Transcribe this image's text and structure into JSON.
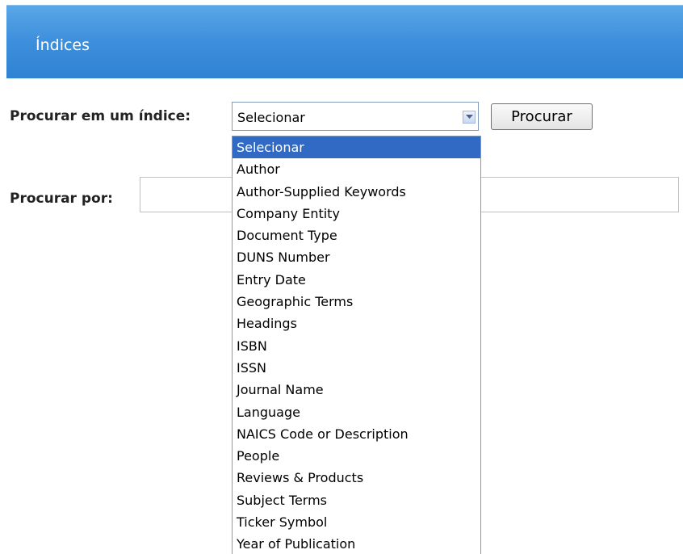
{
  "header": {
    "title": "Índices"
  },
  "index_search": {
    "label": "Procurar em um índice:",
    "selected": "Selecionar",
    "button_label": "Procurar"
  },
  "search_for": {
    "label": "Procurar por:",
    "value": ""
  },
  "dropdown": {
    "options": [
      "Selecionar",
      "Author",
      "Author-Supplied Keywords",
      "Company Entity",
      "Document Type",
      "DUNS Number",
      "Entry Date",
      "Geographic Terms",
      "Headings",
      "ISBN",
      "ISSN",
      "Journal Name",
      "Language",
      "NAICS Code or Description",
      "People",
      "Reviews & Products",
      "Subject Terms",
      "Ticker Symbol",
      "Year of Publication"
    ]
  },
  "colors": {
    "header_blue": "#3f91dd",
    "selection_blue": "#316ac5"
  }
}
